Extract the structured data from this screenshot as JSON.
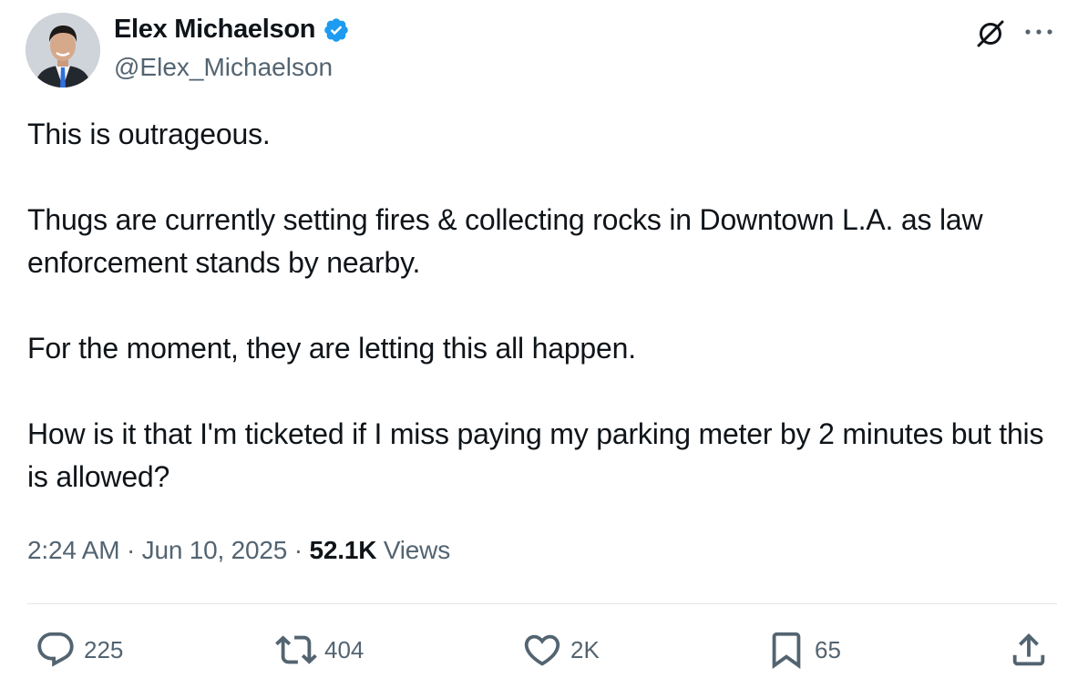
{
  "author": {
    "display_name": "Elex Michaelson",
    "handle": "@Elex_Michaelson",
    "verified": true
  },
  "tweet": {
    "paragraphs": [
      "This is outrageous.",
      "Thugs are currently setting fires & collecting rocks in Downtown L.A. as law enforcement stands by nearby.",
      "For the moment, they are letting this all happen.",
      "How is it that I'm ticketed if I miss paying my parking meter by 2 minutes but this is allowed?"
    ],
    "time": "2:24 AM",
    "separator": "·",
    "date": "Jun 10, 2025",
    "views_count": "52.1K",
    "views_label": "Views"
  },
  "actions": {
    "reply_count": "225",
    "retweet_count": "404",
    "like_count": "2K",
    "bookmark_count": "65"
  },
  "icons": {
    "grok": "grok-icon",
    "more": "more-horizontal-icon",
    "reply": "reply-icon",
    "retweet": "retweet-icon",
    "like": "heart-icon",
    "bookmark": "bookmark-icon",
    "share": "share-icon",
    "verified": "verified-badge-icon"
  },
  "colors": {
    "verified_blue": "#1d9bf0",
    "text_primary": "#0f1419",
    "text_secondary": "#536471",
    "divider": "#e1e6ea"
  }
}
